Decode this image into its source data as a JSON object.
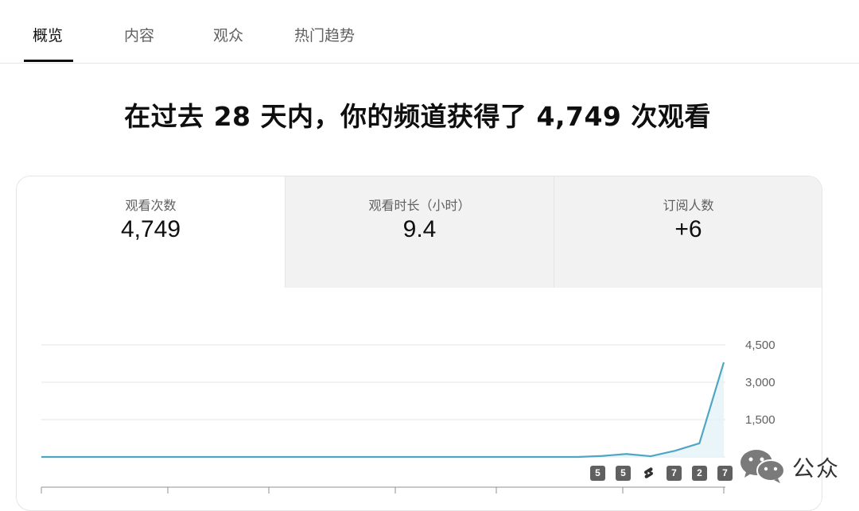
{
  "tabs": [
    {
      "label": "概览",
      "active": true
    },
    {
      "label": "内容",
      "active": false
    },
    {
      "label": "观众",
      "active": false
    },
    {
      "label": "热门趋势",
      "active": false
    }
  ],
  "headline": "在过去 28 天内，你的频道获得了 4,749 次观看",
  "metrics": [
    {
      "label": "观看次数",
      "value": "4,749",
      "selected": true
    },
    {
      "label": "观看时长（小时）",
      "value": "9.4",
      "selected": false
    },
    {
      "label": "订阅人数",
      "value": "+6",
      "selected": false
    }
  ],
  "chart_data": {
    "type": "line",
    "series": [
      {
        "values": [
          0,
          0,
          0,
          0,
          0,
          0,
          0,
          0,
          0,
          0,
          0,
          0,
          0,
          0,
          0,
          0,
          0,
          0,
          0,
          0,
          0,
          0,
          0,
          40,
          120,
          30,
          250,
          550,
          3800
        ]
      }
    ],
    "ylim": [
      0,
      4500
    ],
    "yticks": [
      "4,500",
      "3,000",
      "1,500",
      "0"
    ],
    "color": "#4fa6c4"
  },
  "video_markers": [
    "5",
    "5",
    "",
    "7",
    "2",
    "7"
  ],
  "watermark": "公众"
}
